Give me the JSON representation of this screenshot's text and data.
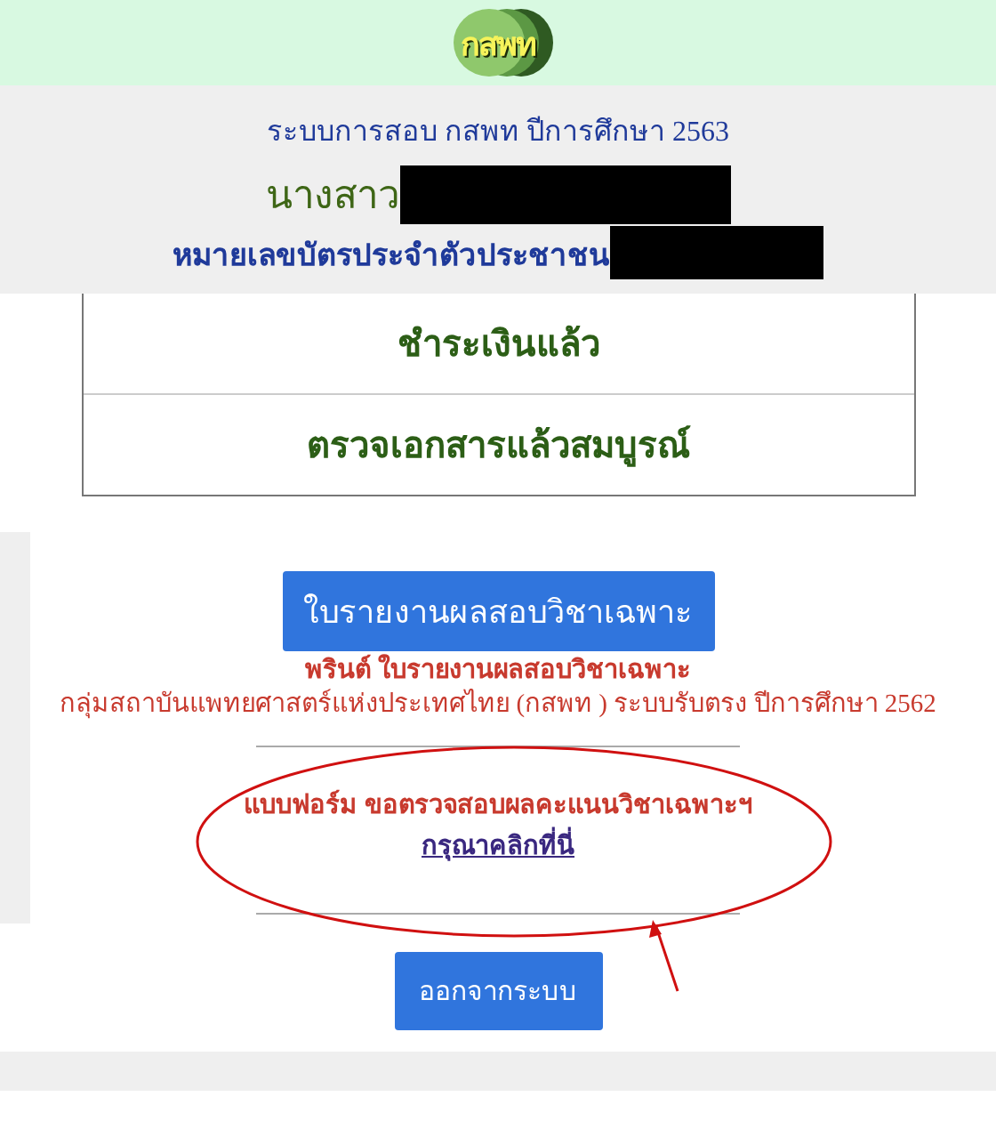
{
  "header": {
    "logo": "กสพท"
  },
  "info": {
    "title": "ระบบการสอบ กสพท ปีการศึกษา 2563",
    "name_prefix": "นางสาว",
    "id_label": "หมายเลขบัตรประจำตัวประชาชน"
  },
  "status_rows": [
    "ชำระเงินแล้ว",
    "ตรวจเอกสารแล้วสมบูรณ์"
  ],
  "report": {
    "button": "ใบรายงานผลสอบวิชาเฉพาะ",
    "lines": [
      "พรินต์ ใบรายงานผลสอบวิชาเฉพาะ",
      "กลุ่มสถาบันแพทยศาสตร์แห่งประเทศไทย (กสพท ) ระบบรับตรง ปีการศึกษา 2562"
    ]
  },
  "appeal": {
    "text": "แบบฟอร์ม ขอตรวจสอบผลคะแนนวิชาเฉพาะฯ",
    "link": "กรุณาคลิกที่นี่"
  },
  "logout": {
    "button": "ออกจากระบบ"
  }
}
